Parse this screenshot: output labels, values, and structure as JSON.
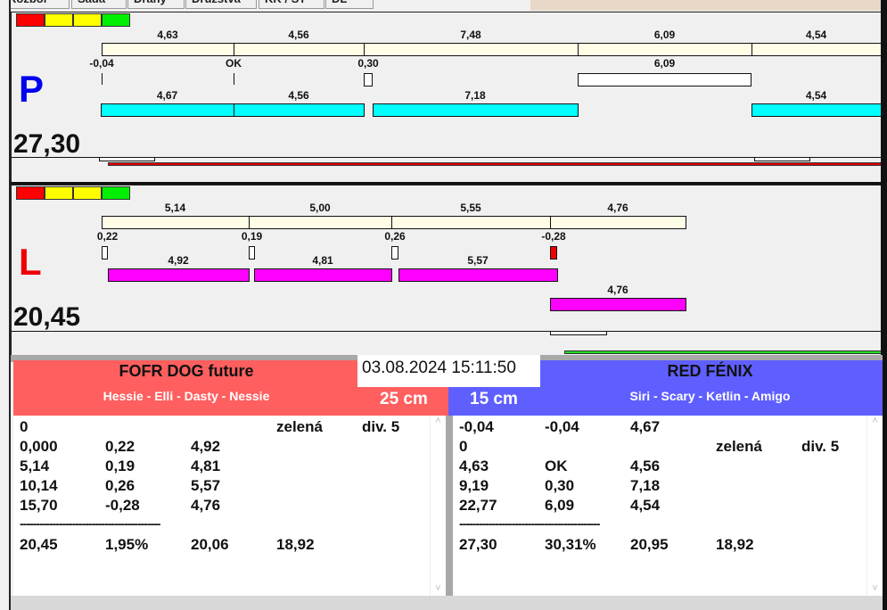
{
  "tabs": [
    "Rozbor",
    "Sada",
    "Dráhy",
    "Družstva",
    "KK / ST",
    "DL"
  ],
  "colors": {
    "red_team": "#ff5f5f",
    "blue_team": "#5f5fff",
    "cyan": "#00ffff",
    "magenta": "#ff00ff",
    "beige": "#fffde6"
  },
  "lane_p": {
    "letter": "P",
    "total": "27,30",
    "top_values": [
      "4,63",
      "4,56",
      "7,48",
      "6,09",
      "4,54"
    ],
    "diff_values": [
      "-0,04",
      "OK",
      "0,30",
      "6,09"
    ],
    "bar_values": [
      "4,67",
      "4,56",
      "7,18",
      "4,54"
    ]
  },
  "lane_l": {
    "letter": "L",
    "total": "20,45",
    "top_values": [
      "5,14",
      "5,00",
      "5,55",
      "4,76"
    ],
    "diff_values": [
      "0,22",
      "0,19",
      "0,26",
      "-0,28"
    ],
    "bar_values": [
      "4,92",
      "4,81",
      "5,57",
      "4,76"
    ]
  },
  "datetime": "03.08.2024 15:11:50",
  "team_left": {
    "name": "FOFR DOG future",
    "dogs": "Hessie - Elli - Dasty - Nessie",
    "distance": "25 cm",
    "rows": [
      [
        "0",
        "",
        "",
        "zelená",
        "div. 5"
      ],
      [
        "0,000",
        "0,22",
        "4,92",
        "",
        ""
      ],
      [
        "5,14",
        "0,19",
        "4,81",
        "",
        ""
      ],
      [
        "10,14",
        "0,26",
        "5,57",
        "",
        ""
      ],
      [
        "15,70",
        "-0,28",
        "4,76",
        "",
        ""
      ],
      [
        "-------------------------------------------",
        "",
        "",
        "",
        ""
      ],
      [
        "20,45",
        "1,95%",
        "20,06",
        "18,92",
        ""
      ]
    ]
  },
  "team_right": {
    "name": "RED FÉNIX",
    "dogs": "Siri - Scary - Ketlin - Amigo",
    "distance": "15 cm",
    "rows": [
      [
        "-0,04",
        "-0,04",
        "4,67",
        "",
        ""
      ],
      [
        "0",
        "",
        "",
        "zelená",
        "div. 5"
      ],
      [
        "4,63",
        "OK",
        "4,56",
        "",
        ""
      ],
      [
        "9,19",
        "0,30",
        "7,18",
        "",
        ""
      ],
      [
        "22,77",
        "6,09",
        "4,54",
        "",
        ""
      ],
      [
        "-------------------------------------------",
        "",
        "",
        "",
        ""
      ],
      [
        "27,30",
        "30,31%",
        "20,95",
        "18,92",
        ""
      ]
    ]
  }
}
